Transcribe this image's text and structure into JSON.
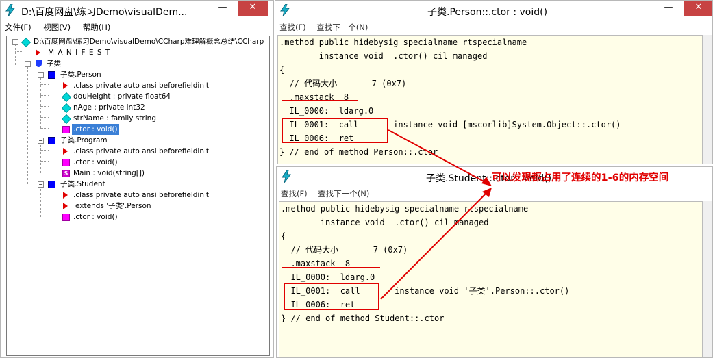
{
  "left_window": {
    "title": "D:\\百度网盘\\练习Demo\\visualDem...",
    "menu": [
      "文件(F)",
      "视图(V)",
      "帮助(H)"
    ],
    "tree": [
      {
        "label": "D:\\百度网盘\\练习Demo\\visualDemo\\CCharp难理解概念总结\\CCharp"
      },
      {
        "label": "M A N I F E S T"
      },
      {
        "label": "子类"
      },
      {
        "label": "子类.Person"
      },
      {
        "label": ".class private auto ansi beforefieldinit"
      },
      {
        "label": "douHeight : private float64"
      },
      {
        "label": "nAge : private int32"
      },
      {
        "label": "strName : family string"
      },
      {
        "label": ".ctor : void()"
      },
      {
        "label": "子类.Program"
      },
      {
        "label": ".class private auto ansi beforefieldinit"
      },
      {
        "label": ".ctor : void()"
      },
      {
        "label": "Main : void(string[])"
      },
      {
        "label": "子类.Student"
      },
      {
        "label": ".class private auto ansi beforefieldinit"
      },
      {
        "label": "extends '子类'.Person"
      },
      {
        "label": ".ctor : void()"
      }
    ]
  },
  "top_code_window": {
    "title": "子类.Person::.ctor : void()",
    "search": [
      "查找(F)",
      "查找下一个(N)"
    ],
    "lines": [
      ".method public hidebysig specialname rtspecialname",
      "        instance void  .ctor() cil managed",
      "{",
      "  // 代码大小       7 (0x7)",
      "  .maxstack  8",
      "  IL_0000:  ldarg.0",
      "  IL_0001:  call       instance void [mscorlib]System.Object::.ctor()",
      "  IL_0006:  ret",
      "} // end of method Person::.ctor"
    ]
  },
  "bottom_code_window": {
    "title": "子类.Student::.ctor : void()",
    "search": [
      "查找(F)",
      "查找下一个(N)"
    ],
    "lines": [
      ".method public hidebysig specialname rtspecialname",
      "        instance void  .ctor() cil managed",
      "{",
      "  // 代码大小       7 (0x7)",
      "  .maxstack  8",
      "  IL_0000:  ldarg.0",
      "  IL_0001:  call       instance void '子类'.Person::.ctor()",
      "  IL_0006:  ret",
      "} // end of method Student::.ctor"
    ]
  },
  "annotation": "可以发现都占用了连续的1-6的内存空间",
  "window_buttons": {
    "minimize": "—",
    "close": "✕"
  },
  "colors": {
    "annotation": "#e00000",
    "code_bg": "#fffee8",
    "selection": "#3a7fd6"
  }
}
